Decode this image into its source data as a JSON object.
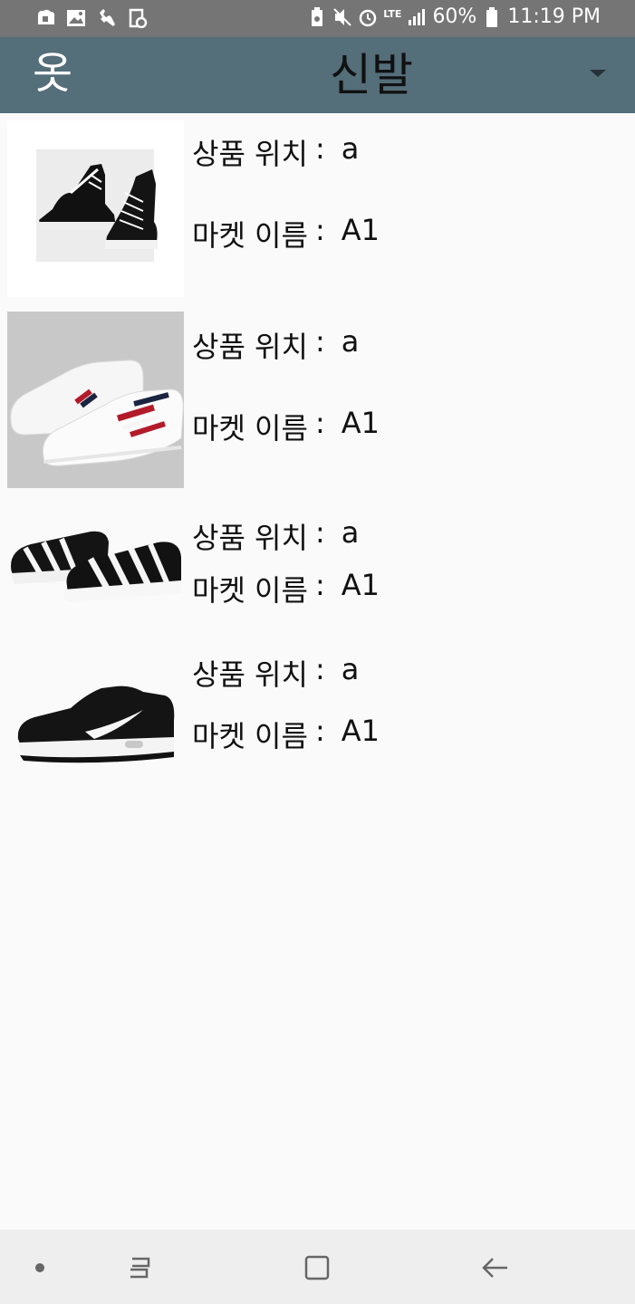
{
  "status_bar": {
    "battery": "60%",
    "time": "11:19 PM",
    "network": "LTE",
    "left_icons": [
      "cloud-shield-icon",
      "image-icon",
      "wrench-icon",
      "file-sync-icon"
    ],
    "right_icons": [
      "battery-saver-icon",
      "mute-icon",
      "alarm-icon",
      "signal-icon",
      "battery-icon"
    ]
  },
  "app_bar": {
    "nav_label": "옷",
    "title": "신발",
    "dropdown_icon": "caret-down-icon",
    "background": "#546e7a"
  },
  "items": [
    {
      "location_label": "상품 위치",
      "location_value": "a",
      "market_label": "마켓 이름",
      "market_value": "A1",
      "image": "black-high-top-sneakers"
    },
    {
      "location_label": "상품 위치",
      "location_value": "a",
      "market_label": "마켓 이름",
      "market_value": "A1",
      "image": "white-striped-sneakers"
    },
    {
      "location_label": "상품 위치",
      "location_value": "a",
      "market_label": "마켓 이름",
      "market_value": "A1",
      "image": "black-white-strap-slip-ons"
    },
    {
      "location_label": "상품 위치",
      "location_value": "a",
      "market_label": "마켓 이름",
      "market_value": "A1",
      "image": "black-running-shoe"
    }
  ],
  "separator": ":",
  "nav_bar": {
    "buttons": [
      "dot-icon",
      "recent-apps-icon",
      "home-icon",
      "back-icon"
    ]
  }
}
